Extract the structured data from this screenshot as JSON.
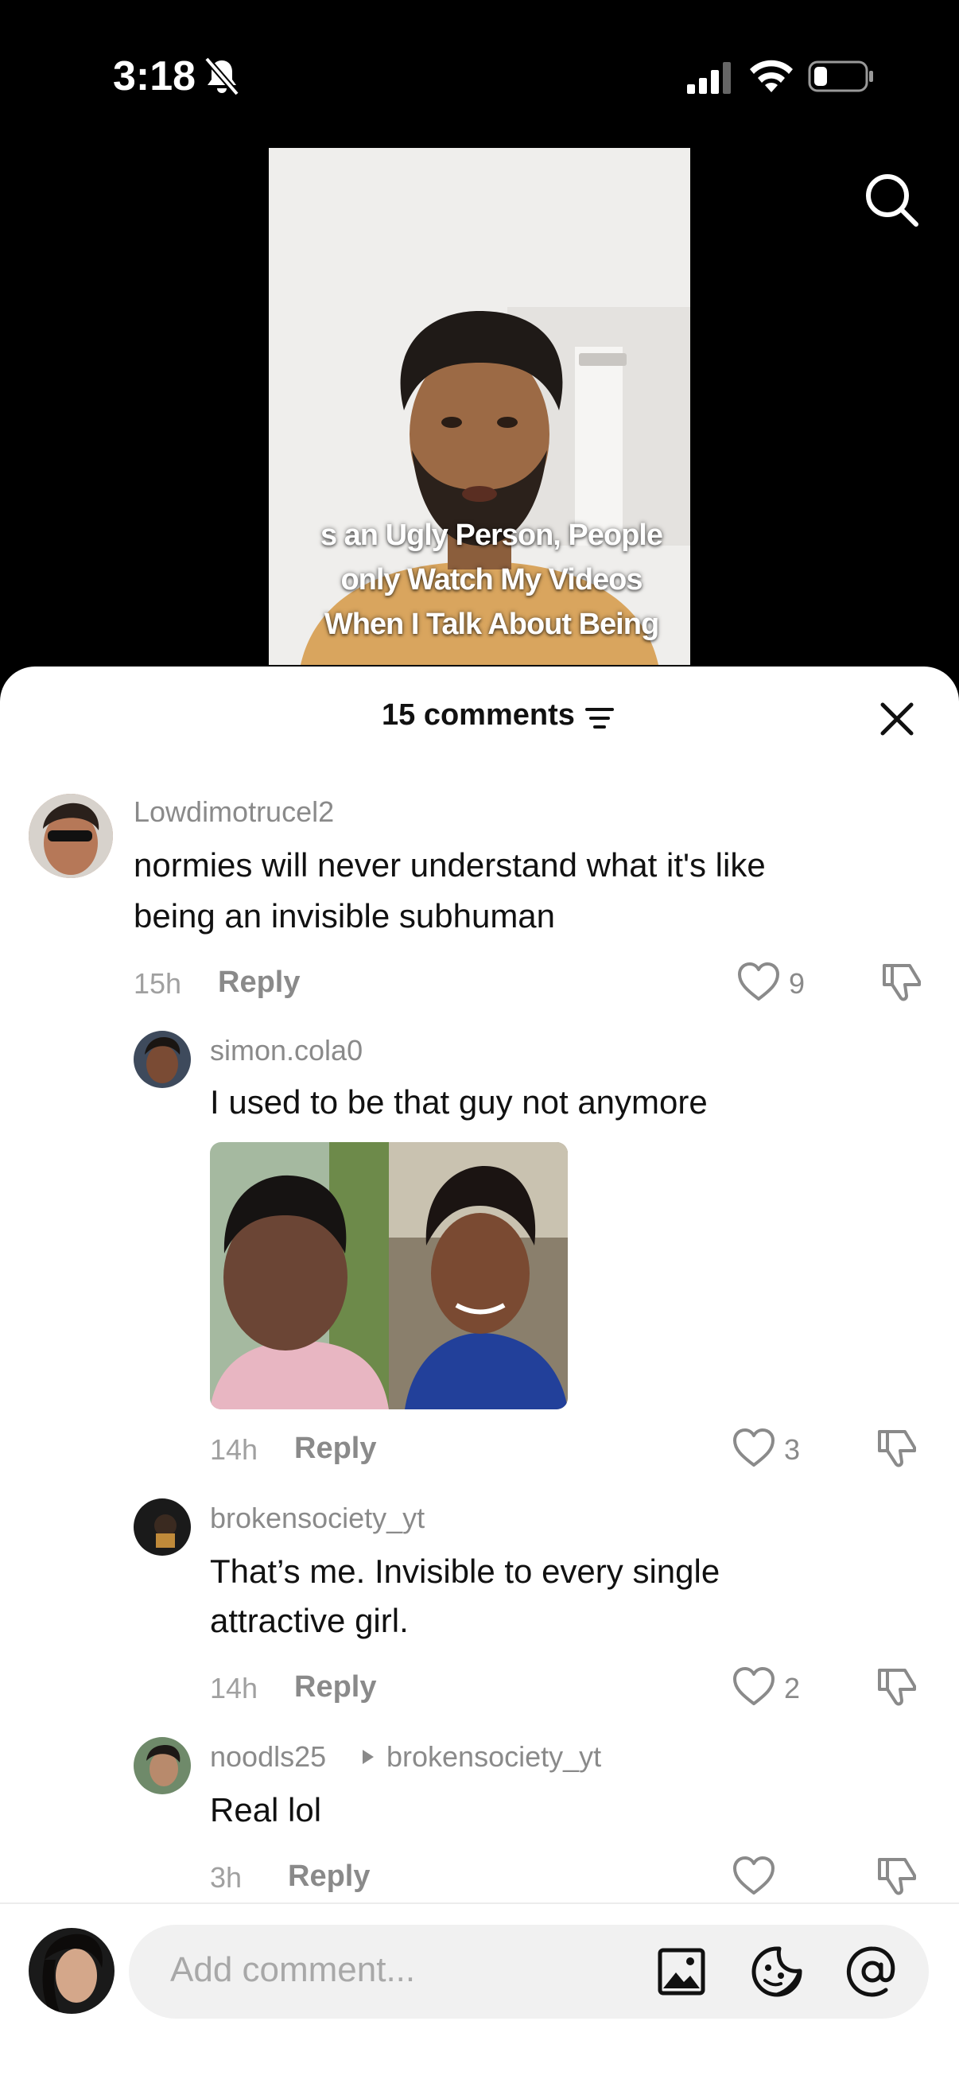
{
  "status_bar": {
    "time": "3:18"
  },
  "video": {
    "caption_lines": [
      "s an Ugly Person, People",
      "only Watch My Videos",
      "When I Talk About Being"
    ]
  },
  "comments_sheet": {
    "count_label": "15 comments",
    "comments": [
      {
        "username": "Lowdimotrucel2",
        "text_lines": [
          "normies will never understand what it's like",
          "being an invisible subhuman"
        ],
        "time": "15h",
        "reply_label": "Reply",
        "likes": "9"
      },
      {
        "username": "simon.cola0",
        "text_lines": [
          "I used to be that guy not anymore"
        ],
        "time": "14h",
        "reply_label": "Reply",
        "likes": "3"
      },
      {
        "username": "brokensociety_yt",
        "text_lines": [
          "That’s me. Invisible to every single",
          "attractive girl."
        ],
        "time": "14h",
        "reply_label": "Reply",
        "likes": "2"
      },
      {
        "username": "noodls25",
        "reply_to": "brokensociety_yt",
        "text_lines": [
          "Real lol"
        ],
        "time": "3h",
        "reply_label": "Reply",
        "likes": ""
      }
    ]
  },
  "composer": {
    "placeholder": "Add comment..."
  },
  "colors": {
    "accent_text": "#111111",
    "muted": "#8a8a8a",
    "sheet_bg": "#ffffff",
    "input_bg": "#f1f1f1"
  },
  "icons": [
    "muted-bell-icon",
    "signal-icon",
    "wifi-icon",
    "battery-icon",
    "search-icon",
    "filter-icon",
    "close-icon",
    "heart-icon",
    "dislike-icon",
    "image-icon",
    "sticker-icon",
    "mention-icon"
  ]
}
